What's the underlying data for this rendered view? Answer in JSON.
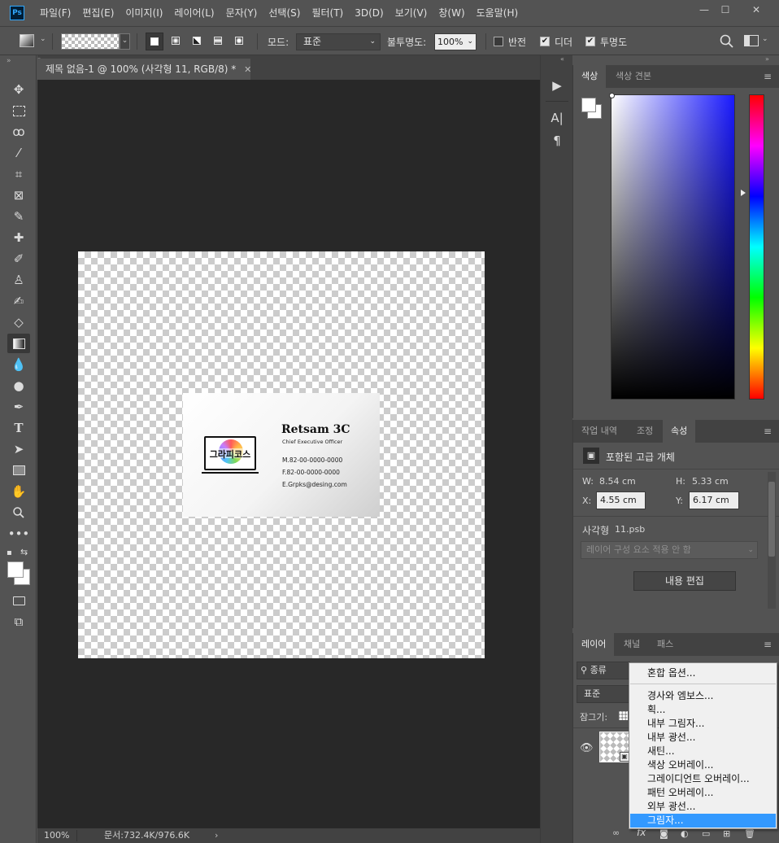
{
  "app": {
    "logo": "Ps"
  },
  "menu": [
    "파일(F)",
    "편집(E)",
    "이미지(I)",
    "레이어(L)",
    "문자(Y)",
    "선택(S)",
    "필터(T)",
    "3D(D)",
    "보기(V)",
    "창(W)",
    "도움말(H)"
  ],
  "window_controls": [
    "—",
    "☐",
    "✕"
  ],
  "options": {
    "mode_label": "모드:",
    "mode_value": "표준",
    "opacity_label": "불투명도:",
    "opacity_value": "100%",
    "reverse_label": "반전",
    "reverse_checked": false,
    "dither_label": "디더",
    "dither_checked": true,
    "transparency_label": "투명도",
    "transparency_checked": true
  },
  "document": {
    "tab_title": "제목 없음-1 @ 100% (사각형 11, RGB/8) *",
    "zoom": "100%",
    "doc_info": "문서:732.4K/976.6K"
  },
  "card": {
    "logo_text": "그라피코스",
    "name": "Retsam 3C",
    "title": "Chief Executive Officer",
    "mobile": "M.82-00-0000-0000",
    "fax": "F.82-00-0000-0000",
    "email": "E.Grpks@desing.com"
  },
  "color_panel": {
    "tabs": [
      "색상",
      "색상 견본"
    ],
    "active_tab": "색상",
    "accent_hue": "#1a1aff"
  },
  "properties_panel": {
    "tabs": [
      "작업 내역",
      "조정",
      "속성"
    ],
    "active_tab": "속성",
    "object_type": "포함된 고급 개체",
    "w_label": "W:",
    "w_value": "8.54 cm",
    "h_label": "H:",
    "h_value": "5.33 cm",
    "x_label": "X:",
    "x_value": "4.55 cm",
    "y_label": "Y:",
    "y_value": "6.17 cm",
    "layer_file_label": "사각형",
    "layer_file": "11.psb",
    "comp_select": "레이어 구성 요소 적용 안 함",
    "edit_button": "내용 편집"
  },
  "layers_panel": {
    "tabs": [
      "레이어",
      "채널",
      "패스"
    ],
    "active_tab": "레이어",
    "filter_label": "종류",
    "blend_mode": "표준",
    "lock_label": "잠그기:"
  },
  "context_menu": {
    "items": [
      "혼합 옵션...",
      "경사와 엠보스...",
      "획...",
      "내부 그림자...",
      "내부 광선...",
      "새틴...",
      "색상 오버레이...",
      "그레이디언트 오버레이...",
      "패턴 오버레이...",
      "외부 광선...",
      "그림자..."
    ],
    "highlighted": "그림자..."
  }
}
